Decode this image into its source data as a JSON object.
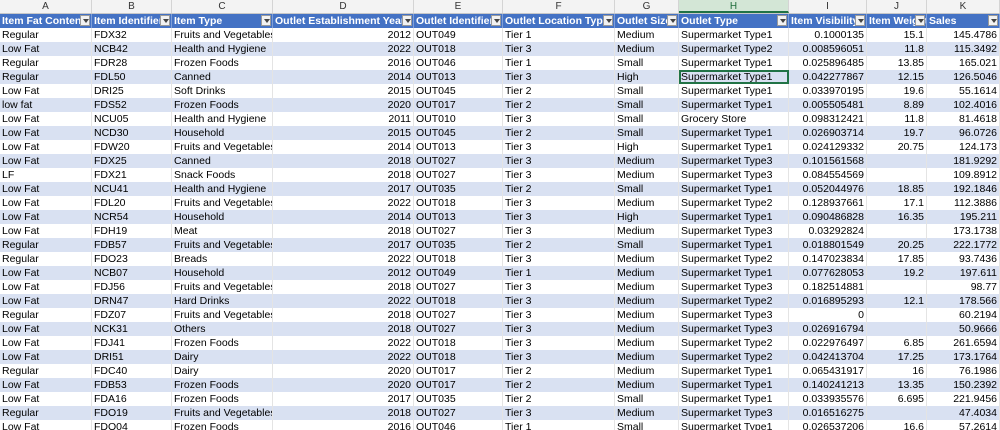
{
  "column_letters": [
    "A",
    "B",
    "C",
    "D",
    "E",
    "F",
    "G",
    "H",
    "I",
    "J",
    "K"
  ],
  "selected_column": "H",
  "headers": [
    "Item Fat Content",
    "Item Identifier",
    "Item Type",
    "Outlet Establishment Year",
    "Outlet Identifier",
    "Outlet Location Type",
    "Outlet Size",
    "Outlet Type",
    "Item Visibility",
    "Item Weight",
    "Sales"
  ],
  "rows": [
    [
      "Regular",
      "FDX32",
      "Fruits and Vegetables",
      "2012",
      "OUT049",
      "Tier 1",
      "Medium",
      "Supermarket Type1",
      "0.1000135",
      "15.1",
      "145.4786"
    ],
    [
      "Low Fat",
      "NCB42",
      "Health and Hygiene",
      "2022",
      "OUT018",
      "Tier 3",
      "Medium",
      "Supermarket Type2",
      "0.008596051",
      "11.8",
      "115.3492"
    ],
    [
      "Regular",
      "FDR28",
      "Frozen Foods",
      "2016",
      "OUT046",
      "Tier 1",
      "Small",
      "Supermarket Type1",
      "0.025896485",
      "13.85",
      "165.021"
    ],
    [
      "Regular",
      "FDL50",
      "Canned",
      "2014",
      "OUT013",
      "Tier 3",
      "High",
      "Supermarket Type1",
      "0.042277867",
      "12.15",
      "126.5046"
    ],
    [
      "Low Fat",
      "DRI25",
      "Soft Drinks",
      "2015",
      "OUT045",
      "Tier 2",
      "Small",
      "Supermarket Type1",
      "0.033970195",
      "19.6",
      "55.1614"
    ],
    [
      "low fat",
      "FDS52",
      "Frozen Foods",
      "2020",
      "OUT017",
      "Tier 2",
      "Small",
      "Supermarket Type1",
      "0.005505481",
      "8.89",
      "102.4016"
    ],
    [
      "Low Fat",
      "NCU05",
      "Health and Hygiene",
      "2011",
      "OUT010",
      "Tier 3",
      "Small",
      "Grocery Store",
      "0.098312421",
      "11.8",
      "81.4618"
    ],
    [
      "Low Fat",
      "NCD30",
      "Household",
      "2015",
      "OUT045",
      "Tier 2",
      "Small",
      "Supermarket Type1",
      "0.026903714",
      "19.7",
      "96.0726"
    ],
    [
      "Low Fat",
      "FDW20",
      "Fruits and Vegetables",
      "2014",
      "OUT013",
      "Tier 3",
      "High",
      "Supermarket Type1",
      "0.024129332",
      "20.75",
      "124.173"
    ],
    [
      "Low Fat",
      "FDX25",
      "Canned",
      "2018",
      "OUT027",
      "Tier 3",
      "Medium",
      "Supermarket Type3",
      "0.101561568",
      "",
      "181.9292"
    ],
    [
      "LF",
      "FDX21",
      "Snack Foods",
      "2018",
      "OUT027",
      "Tier 3",
      "Medium",
      "Supermarket Type3",
      "0.084554569",
      "",
      "109.8912"
    ],
    [
      "Low Fat",
      "NCU41",
      "Health and Hygiene",
      "2017",
      "OUT035",
      "Tier 2",
      "Small",
      "Supermarket Type1",
      "0.052044976",
      "18.85",
      "192.1846"
    ],
    [
      "Low Fat",
      "FDL20",
      "Fruits and Vegetables",
      "2022",
      "OUT018",
      "Tier 3",
      "Medium",
      "Supermarket Type2",
      "0.128937661",
      "17.1",
      "112.3886"
    ],
    [
      "Low Fat",
      "NCR54",
      "Household",
      "2014",
      "OUT013",
      "Tier 3",
      "High",
      "Supermarket Type1",
      "0.090486828",
      "16.35",
      "195.211"
    ],
    [
      "Low Fat",
      "FDH19",
      "Meat",
      "2018",
      "OUT027",
      "Tier 3",
      "Medium",
      "Supermarket Type3",
      "0.03292824",
      "",
      "173.1738"
    ],
    [
      "Regular",
      "FDB57",
      "Fruits and Vegetables",
      "2017",
      "OUT035",
      "Tier 2",
      "Small",
      "Supermarket Type1",
      "0.018801549",
      "20.25",
      "222.1772"
    ],
    [
      "Regular",
      "FDO23",
      "Breads",
      "2022",
      "OUT018",
      "Tier 3",
      "Medium",
      "Supermarket Type2",
      "0.147023834",
      "17.85",
      "93.7436"
    ],
    [
      "Low Fat",
      "NCB07",
      "Household",
      "2012",
      "OUT049",
      "Tier 1",
      "Medium",
      "Supermarket Type1",
      "0.077628053",
      "19.2",
      "197.611"
    ],
    [
      "Low Fat",
      "FDJ56",
      "Fruits and Vegetables",
      "2018",
      "OUT027",
      "Tier 3",
      "Medium",
      "Supermarket Type3",
      "0.182514881",
      "",
      "98.77"
    ],
    [
      "Low Fat",
      "DRN47",
      "Hard Drinks",
      "2022",
      "OUT018",
      "Tier 3",
      "Medium",
      "Supermarket Type2",
      "0.016895293",
      "12.1",
      "178.566"
    ],
    [
      "Regular",
      "FDZ07",
      "Fruits and Vegetables",
      "2018",
      "OUT027",
      "Tier 3",
      "Medium",
      "Supermarket Type3",
      "0",
      "",
      "60.2194"
    ],
    [
      "Low Fat",
      "NCK31",
      "Others",
      "2018",
      "OUT027",
      "Tier 3",
      "Medium",
      "Supermarket Type3",
      "0.026916794",
      "",
      "50.9666"
    ],
    [
      "Low Fat",
      "FDJ41",
      "Frozen Foods",
      "2022",
      "OUT018",
      "Tier 3",
      "Medium",
      "Supermarket Type2",
      "0.022976497",
      "6.85",
      "261.6594"
    ],
    [
      "Low Fat",
      "DRI51",
      "Dairy",
      "2022",
      "OUT018",
      "Tier 3",
      "Medium",
      "Supermarket Type2",
      "0.042413704",
      "17.25",
      "173.1764"
    ],
    [
      "Regular",
      "FDC40",
      "Dairy",
      "2020",
      "OUT017",
      "Tier 2",
      "Medium",
      "Supermarket Type1",
      "0.065431917",
      "16",
      "76.1986"
    ],
    [
      "Low Fat",
      "FDB53",
      "Frozen Foods",
      "2020",
      "OUT017",
      "Tier 2",
      "Medium",
      "Supermarket Type1",
      "0.140241213",
      "13.35",
      "150.2392"
    ],
    [
      "Low Fat",
      "FDA16",
      "Frozen Foods",
      "2017",
      "OUT035",
      "Tier 2",
      "Small",
      "Supermarket Type1",
      "0.033935576",
      "6.695",
      "221.9456"
    ],
    [
      "Regular",
      "FDO19",
      "Fruits and Vegetables",
      "2018",
      "OUT027",
      "Tier 3",
      "Medium",
      "Supermarket Type3",
      "0.016516275",
      "",
      "47.4034"
    ],
    [
      "Low Fat",
      "FDO04",
      "Frozen Foods",
      "2016",
      "OUT046",
      "Tier 1",
      "Small",
      "Supermarket Type1",
      "0.026537206",
      "16.6",
      "57.2614"
    ]
  ],
  "colors": {
    "header_bg": "#4472c4",
    "band": "#d9e1f2",
    "selection": "#217346"
  }
}
